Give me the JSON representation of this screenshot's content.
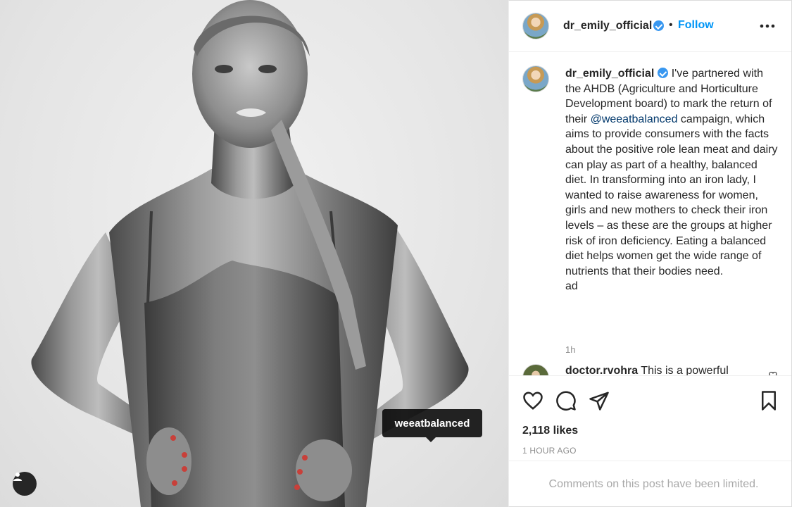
{
  "post": {
    "photo_tag": "weeatbalanced",
    "tag_icon": "user-silhouette-icon"
  },
  "header": {
    "username": "dr_emily_official",
    "separator": "•",
    "follow_label": "Follow",
    "more_icon": "more-horizontal-icon"
  },
  "caption": {
    "username": "dr_emily_official",
    "text_before_mention": " I've partnered with the AHDB (Agriculture and Horticulture Development board) to mark the return of their ",
    "mention": "@weeatbalanced",
    "text_after_mention": " campaign, which aims to provide consumers with the facts about the positive role lean meat and dairy can play as part of a healthy, balanced diet. In transforming into an iron lady, I wanted to raise awareness for women, girls and new mothers to check their iron levels – as these are the groups at higher risk of iron deficiency. Eating a balanced diet helps women get the wide range of nutrients that their bodies need.",
    "ad_label": "ad",
    "time": "1h"
  },
  "next_comment": {
    "username": "doctor.rvohra",
    "text": " This is a powerful"
  },
  "actions": {
    "like_icon": "heart-icon",
    "comment_icon": "comment-icon",
    "share_icon": "paper-plane-icon",
    "save_icon": "bookmark-icon"
  },
  "likes_text": "2,118 likes",
  "timestamp": "1 HOUR AGO",
  "comments_limited": "Comments on this post have been limited.",
  "colors": {
    "link_blue": "#0095f6",
    "verified_blue": "#3897f0",
    "mention": "#00376b",
    "muted": "#8e8e8e"
  }
}
